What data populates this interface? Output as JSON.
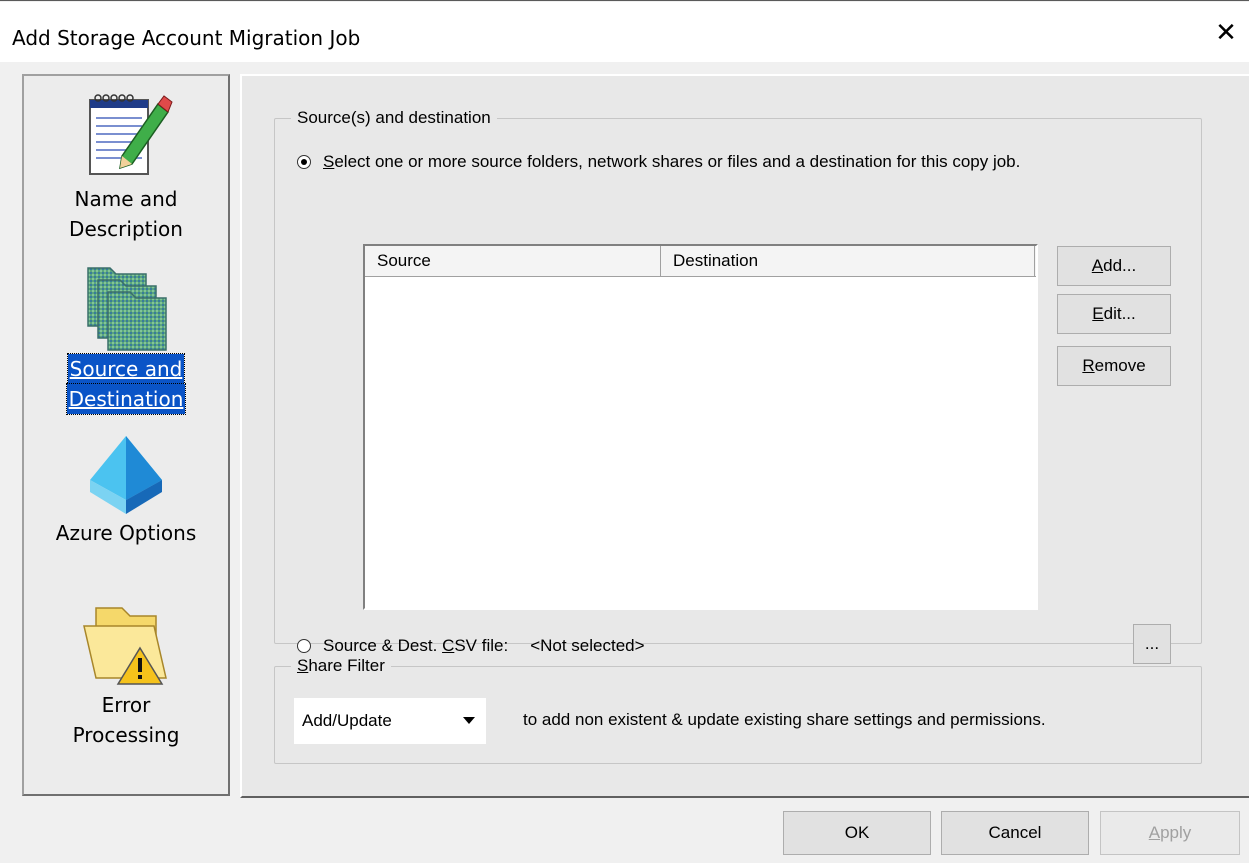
{
  "window": {
    "title": "Add Storage Account Migration Job",
    "close_glyph": "✕"
  },
  "sidebar": {
    "items": [
      {
        "id": "name",
        "label_l1": "Name and",
        "label_l2": "Description",
        "icon": "notepad-pencil-icon",
        "selected": false
      },
      {
        "id": "source",
        "label_l1": "Source and",
        "label_l2": "Destination",
        "icon": "folders-icon",
        "selected": true
      },
      {
        "id": "azure",
        "label_l1": "Azure Options",
        "icon": "azure-diamond-icon",
        "selected": false
      },
      {
        "id": "error",
        "label_l1": "Error",
        "label_l2": "Processing",
        "icon": "folder-warning-icon",
        "selected": false
      }
    ]
  },
  "sources_group": {
    "legend": "Source(s) and destination",
    "radio_select": {
      "first": "S",
      "rest": "elect one or more source folders, network shares or files and a destination for this copy job.",
      "checked": true
    },
    "table": {
      "columns": [
        "Source",
        "Destination"
      ],
      "rows": []
    },
    "buttons": {
      "add": {
        "ul": "A",
        "rest": "dd..."
      },
      "edit": {
        "ul": "E",
        "rest": "dit..."
      },
      "remove": {
        "ul": "R",
        "rest": "emove"
      }
    },
    "radio_csv": {
      "pre": "Source & Dest. ",
      "ul": "C",
      "post": "SV file:",
      "checked": false
    },
    "csv_value": "<Not selected>",
    "browse_label": "..."
  },
  "share_filter": {
    "legend_ul": "S",
    "legend_rest": "hare Filter",
    "selected": "Add/Update",
    "description": "to add non existent & update existing share settings and permissions."
  },
  "footer": {
    "ok": "OK",
    "cancel": "Cancel",
    "apply_ul": "A",
    "apply_rest": "pply",
    "apply_disabled": true
  },
  "colors": {
    "selection": "#0a54c7",
    "dialog_bg": "#f0f0f0",
    "panel_bg": "#e8e8e8"
  }
}
